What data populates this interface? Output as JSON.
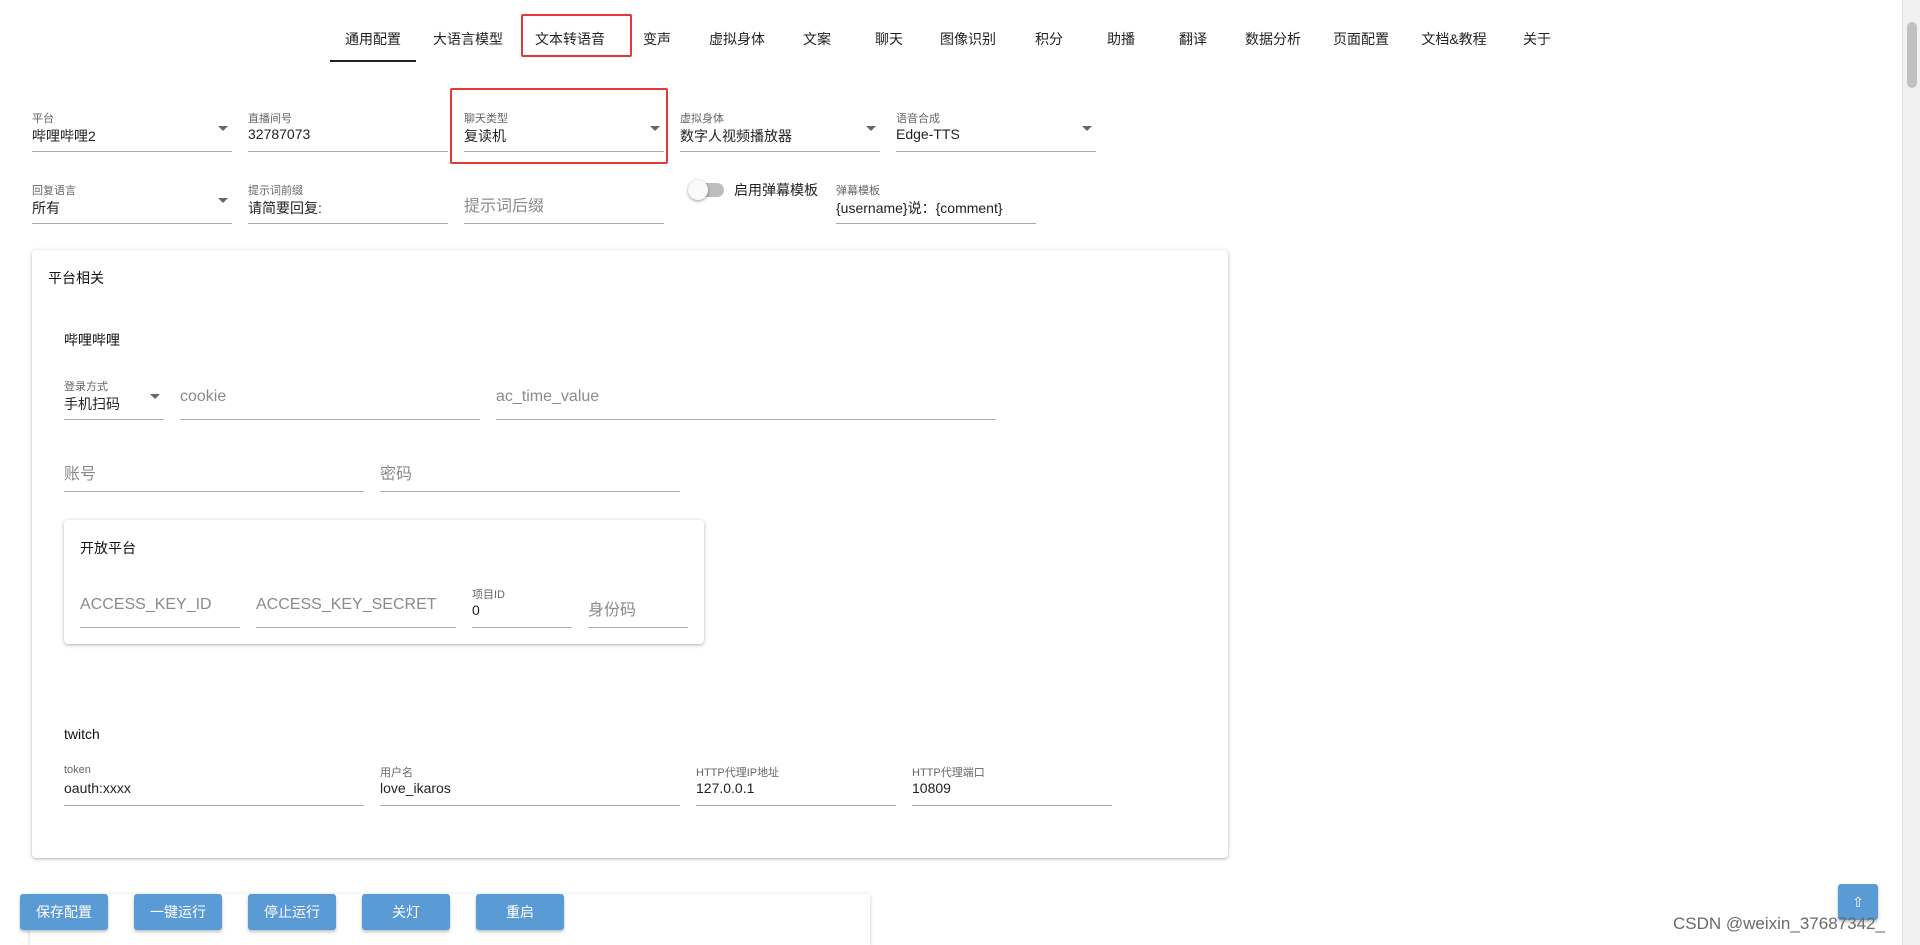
{
  "nav": {
    "tabs": [
      {
        "label": "通用配置",
        "active": true
      },
      {
        "label": "大语言模型"
      },
      {
        "label": "文本转语音",
        "highlighted": true
      },
      {
        "label": "变声"
      },
      {
        "label": "虚拟身体"
      },
      {
        "label": "文案"
      },
      {
        "label": "聊天"
      },
      {
        "label": "图像识别"
      },
      {
        "label": "积分"
      },
      {
        "label": "助播"
      },
      {
        "label": "翻译"
      },
      {
        "label": "数据分析"
      },
      {
        "label": "页面配置"
      },
      {
        "label": "文档&教程"
      },
      {
        "label": "关于"
      }
    ]
  },
  "general": {
    "platform": {
      "label": "平台",
      "value": "哔哩哔哩2"
    },
    "room_id": {
      "label": "直播间号",
      "value": "32787073"
    },
    "chat_type": {
      "label": "聊天类型",
      "value": "复读机"
    },
    "virtual_body": {
      "label": "虚拟身体",
      "value": "数字人视频播放器"
    },
    "tts": {
      "label": "语音合成",
      "value": "Edge-TTS"
    },
    "reply_language": {
      "label": "回复语言",
      "value": "所有"
    },
    "prompt_prefix": {
      "label": "提示词前缀",
      "value": "请简要回复:"
    },
    "prompt_suffix": {
      "placeholder": "提示词后缀"
    },
    "danmaku_switch": {
      "label": "启用弹幕模板"
    },
    "danmaku_template": {
      "label": "弹幕模板",
      "value": "{username}说：{comment}"
    }
  },
  "platform_card": {
    "title": "平台相关",
    "bilibili": {
      "title": "哔哩哔哩",
      "login_method": {
        "label": "登录方式",
        "value": "手机扫码"
      },
      "cookie": {
        "placeholder": "cookie"
      },
      "ac_time_value": {
        "placeholder": "ac_time_value"
      },
      "account": {
        "placeholder": "账号"
      },
      "password": {
        "placeholder": "密码"
      },
      "open_platform": {
        "title": "开放平台",
        "access_key_id": {
          "placeholder": "ACCESS_KEY_ID"
        },
        "access_key_secret": {
          "placeholder": "ACCESS_KEY_SECRET"
        },
        "project_id": {
          "label": "项目ID",
          "value": "0"
        },
        "id_code": {
          "placeholder": "身份码"
        }
      }
    },
    "twitch": {
      "title": "twitch",
      "token": {
        "label": "token",
        "value": "oauth:xxxx"
      },
      "username": {
        "label": "用户名",
        "value": "love_ikaros"
      },
      "http_proxy_ip": {
        "label": "HTTP代理IP地址",
        "value": "127.0.0.1"
      },
      "http_proxy_port": {
        "label": "HTTP代理端口",
        "value": "10809"
      }
    }
  },
  "actions": {
    "save": "保存配置",
    "run": "一键运行",
    "stop": "停止运行",
    "lights_off": "关灯",
    "restart": "重启",
    "to_top": "⇧"
  },
  "watermark": "CSDN @weixin_37687342_"
}
